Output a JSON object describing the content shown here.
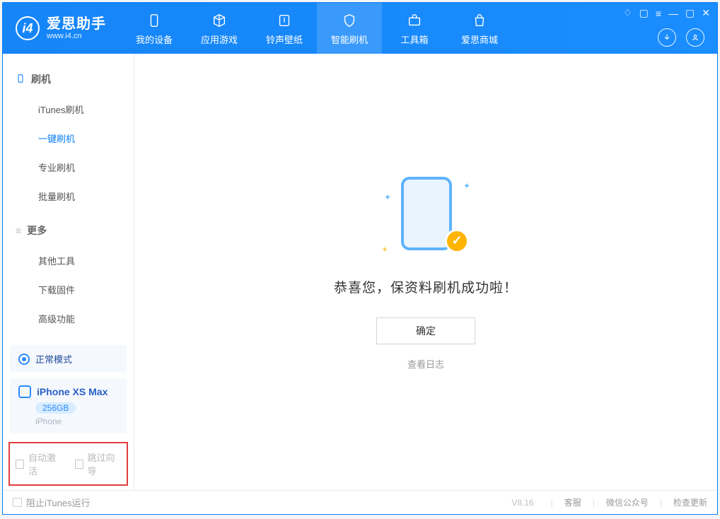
{
  "app": {
    "title": "爱思助手",
    "subtitle": "www.i4.cn"
  },
  "nav": {
    "device": "我的设备",
    "apps": "应用游戏",
    "ring": "铃声壁纸",
    "flash": "智能刷机",
    "tools": "工具箱",
    "store": "爱思商城"
  },
  "sidebar": {
    "section_flash": "刷机",
    "items_flash": {
      "itunes": "iTunes刷机",
      "oneclick": "一键刷机",
      "pro": "专业刷机",
      "batch": "批量刷机"
    },
    "section_more": "更多",
    "items_more": {
      "other": "其他工具",
      "firmware": "下载固件",
      "advanced": "高级功能"
    }
  },
  "device_panel": {
    "mode": "正常模式",
    "name": "iPhone XS Max",
    "storage": "256GB",
    "type": "iPhone"
  },
  "options": {
    "auto_activate": "自动激活",
    "skip_guide": "跳过向导"
  },
  "content": {
    "title": "恭喜您，保资料刷机成功啦！",
    "ok": "确定",
    "log": "查看日志"
  },
  "footer": {
    "block_itunes": "阻止iTunes运行",
    "version": "V8.16",
    "service": "客服",
    "wechat": "微信公众号",
    "update": "检查更新"
  }
}
